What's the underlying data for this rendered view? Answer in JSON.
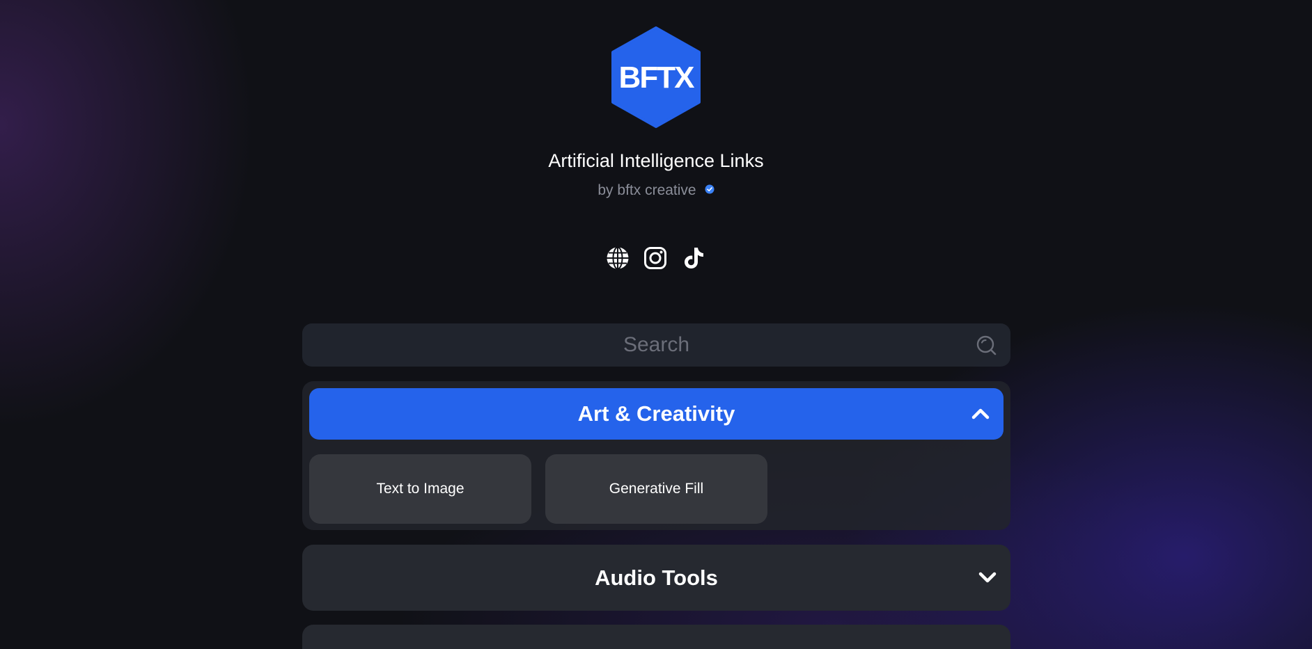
{
  "profile": {
    "logo_text": "BFTX",
    "title": "Artificial Intelligence Links",
    "byline": "by bftx creative"
  },
  "colors": {
    "accent": "#2563eb",
    "background": "#101116",
    "card": "#35373d",
    "panel": "#262930",
    "muted_text": "#8b8e99",
    "verified": "#3b82f6"
  },
  "socials": [
    {
      "name": "website",
      "icon": "globe-icon"
    },
    {
      "name": "instagram",
      "icon": "instagram-icon"
    },
    {
      "name": "tiktok",
      "icon": "tiktok-icon"
    }
  ],
  "search": {
    "placeholder": "Search",
    "value": ""
  },
  "categories": [
    {
      "label": "Art & Creativity",
      "expanded": true,
      "links": [
        {
          "label": "Text to Image"
        },
        {
          "label": "Generative Fill"
        }
      ]
    },
    {
      "label": "Audio Tools",
      "expanded": false,
      "links": []
    }
  ]
}
